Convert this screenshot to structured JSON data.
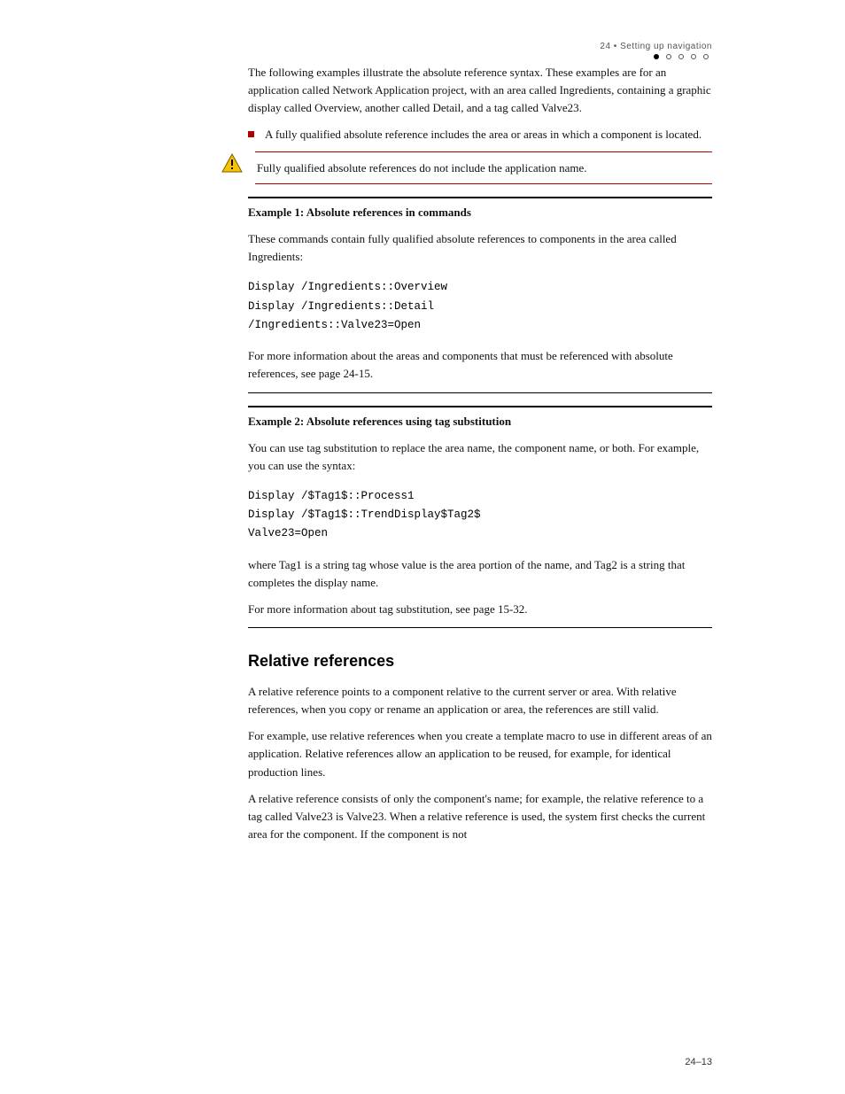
{
  "header": {
    "line1": "24 • Setting up navigation",
    "line2": "• • • • •"
  },
  "intro": "The following examples illustrate the absolute reference syntax. These examples are for an application called Network Application project, with an area called Ingredients, containing a graphic display called Overview, another called Detail, and a tag called Valve23.",
  "bullet": "A fully qualified absolute reference includes the area or areas in which a component is located.",
  "warn": "Fully qualified absolute references do not include the application name.",
  "example1": {
    "heading_prefix": "Example 1: Absolute references in commands",
    "heading_bold": "",
    "intro": "These commands contain fully qualified absolute references to components in the area called Ingredients:",
    "code": "Display /Ingredients::Overview\nDisplay /Ingredients::Detail\n/Ingredients::Valve23=Open",
    "more": "For more information about the areas and components that must be referenced with absolute references, see page 24-15."
  },
  "example2": {
    "heading": "Example 2: Absolute references using tag substitution",
    "para": "You can use tag substitution to replace the area name, the component name, or both. For example, you can use the syntax:",
    "code": "Display /$Tag1$::Process1\nDisplay /$Tag1$::TrendDisplay$Tag2$\nValve23=Open",
    "after1": "where Tag1 is a string tag whose value is the area portion of the name, and Tag2 is a string that completes the display name.",
    "after2": "For more information about tag substitution, see page 15-32."
  },
  "section_heading": "Relative references",
  "rel": {
    "p1": "A relative reference points to a component relative to the current server or area. With relative references, when you copy or rename an application or area, the references are still valid.",
    "p2": "For example, use relative references when you create a template macro to use in different areas of an application. Relative references allow an application to be reused, for example, for identical production lines.",
    "p3": "A relative reference consists of only the component's name; for example, the relative reference to a tag called Valve23 is Valve23. When a relative reference is used, the system first checks the current area for the component. If the component is not"
  },
  "footer": "24–13"
}
